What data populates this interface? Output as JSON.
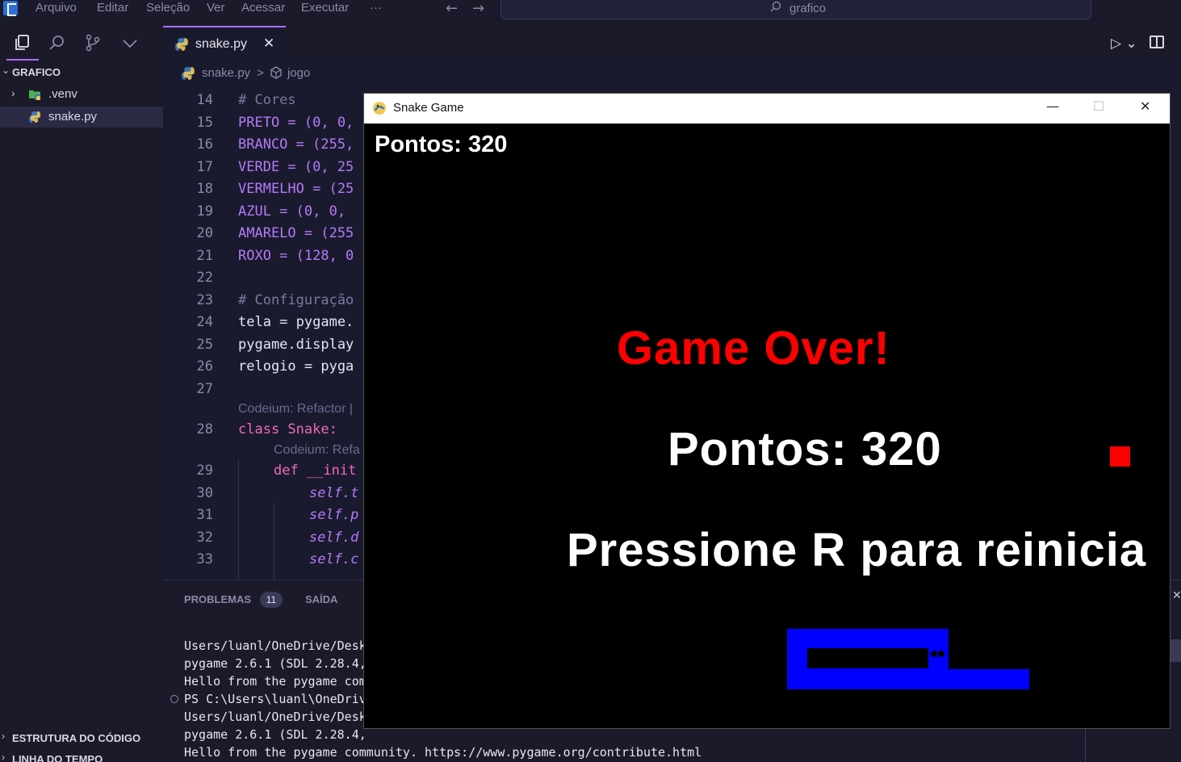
{
  "menu": {
    "items": [
      "Arquivo",
      "Editar",
      "Seleção",
      "Ver",
      "Acessar",
      "Executar",
      "···"
    ],
    "search_text": "grafico"
  },
  "explorer": {
    "root": "GRAFICO",
    "items": [
      {
        "label": ".venv",
        "type": "folder"
      },
      {
        "label": "snake.py",
        "type": "python",
        "active": true
      }
    ],
    "sections": [
      "ESTRUTURA DO CÓDIGO",
      "LINHA DO TEMPO"
    ]
  },
  "editor": {
    "tab": {
      "label": "snake.py",
      "close": "✕"
    },
    "breadcrumb": {
      "file": "snake.py",
      "separator": ">",
      "symbol": "jogo"
    },
    "lines": [
      {
        "n": "14",
        "text": "# Cores"
      },
      {
        "n": "15",
        "text": "PRETO = (0, 0,"
      },
      {
        "n": "16",
        "text": "BRANCO = (255,"
      },
      {
        "n": "17",
        "text": "VERDE = (0, 25"
      },
      {
        "n": "18",
        "text": "VERMELHO = (25"
      },
      {
        "n": "19",
        "text": "AZUL = (0, 0,"
      },
      {
        "n": "20",
        "text": "AMARELO = (255"
      },
      {
        "n": "21",
        "text": "ROXO = (128, 0"
      },
      {
        "n": "22",
        "text": ""
      },
      {
        "n": "23",
        "text": "# Configuração"
      },
      {
        "n": "24",
        "text": "tela = pygame."
      },
      {
        "n": "25",
        "text": "pygame.display"
      },
      {
        "n": "26",
        "text": "relogio = pyga"
      },
      {
        "n": "27",
        "text": ""
      },
      {
        "n": "28",
        "text": "class Snake:"
      },
      {
        "n": "29",
        "text": "def __init"
      },
      {
        "n": "30",
        "text": "self.t"
      },
      {
        "n": "31",
        "text": "self.p"
      },
      {
        "n": "32",
        "text": "self.d"
      },
      {
        "n": "33",
        "text": "self.c"
      }
    ],
    "lens_1": "Codeium: Refactor |",
    "lens_2": "Codeium: Refa"
  },
  "panel": {
    "tabs": [
      "PROBLEMAS",
      "SAÍDA"
    ],
    "problems_count": "11",
    "terminal": [
      "Users/luanl/OneDrive/Desk",
      "pygame 2.6.1 (SDL 2.28.4,",
      "Hello from the pygame com",
      "PS C:\\Users\\luanl\\OneDriv",
      "Users/luanl/OneDrive/Desk",
      "pygame 2.6.1 (SDL 2.28.4,",
      "Hello from the pygame community. https://www.pygame.org/contribute.html"
    ]
  },
  "game": {
    "window_title": "Snake Game",
    "score_top": "Pontos: 320",
    "game_over": "Game Over!",
    "score_center": "Pontos: 320",
    "restart_msg": "Pressione R para reinicia",
    "colors": {
      "food": "#ff0000",
      "snake": "#0000ff",
      "game_over": "#ff0000",
      "background": "#000000"
    }
  }
}
